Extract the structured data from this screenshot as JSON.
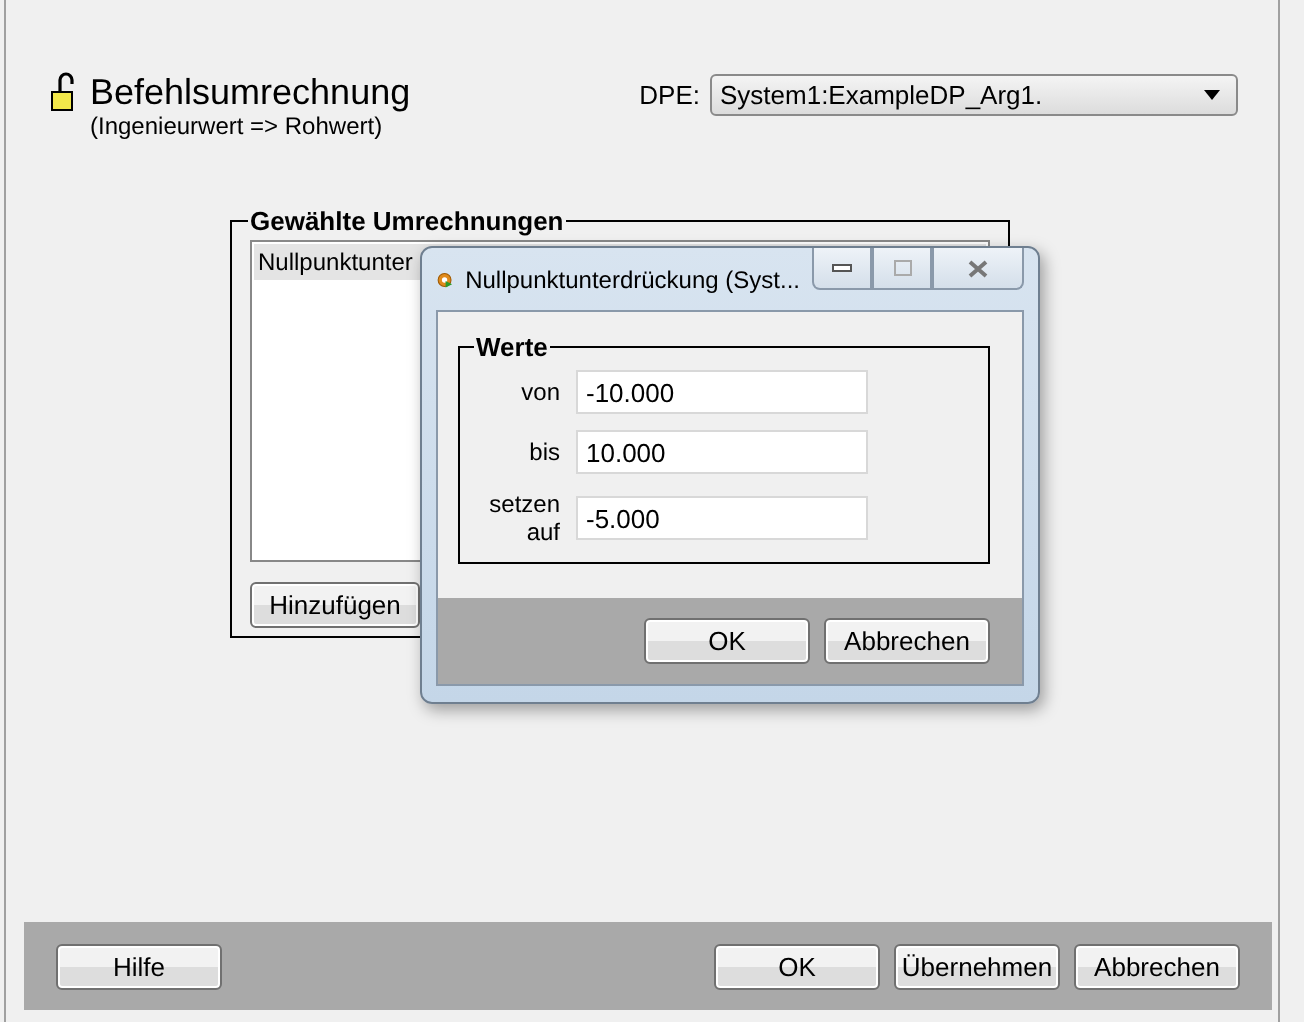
{
  "header": {
    "title": "Befehlsumrechnung",
    "subtitle": "(Ingenieurwert => Rohwert)",
    "dpe_label": "DPE:",
    "dpe_value": "System1:ExampleDP_Arg1."
  },
  "conversions": {
    "title": "Gewählte Umrechnungen",
    "items": [
      {
        "label": "Nullpunktunter",
        "selected": true
      }
    ],
    "add_button": "Hinzufügen"
  },
  "dialog": {
    "title": "Nullpunktunterdrückung (Syst...",
    "group_title": "Werte",
    "fields": [
      {
        "label": "von",
        "value": "-10.000"
      },
      {
        "label": "bis",
        "value": "10.000"
      },
      {
        "label": "setzen auf",
        "value": "-5.000"
      }
    ],
    "buttons": [
      "OK",
      "Abbrechen"
    ]
  },
  "footer": {
    "help_button": "Hilfe",
    "buttons": [
      "OK",
      "Übernehmen",
      "Abbrechen"
    ]
  }
}
